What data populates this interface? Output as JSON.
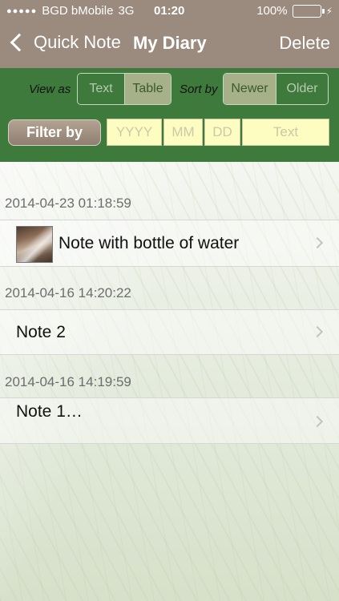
{
  "status_bar": {
    "signal_dots": "●●●●●",
    "carrier": "BGD bMobile",
    "network": "3G",
    "time": "01:20",
    "battery_percent": "100%",
    "battery_level": 1.0,
    "battery_color": "#4cd964"
  },
  "nav": {
    "back_label": "Quick Note",
    "title": "My Diary",
    "action_label": "Delete"
  },
  "controls": {
    "view_as_label": "View as",
    "view_options": [
      {
        "label": "Text",
        "selected": false
      },
      {
        "label": "Table",
        "selected": true
      }
    ],
    "sort_by_label": "Sort by",
    "sort_options": [
      {
        "label": "Newer",
        "selected": true
      },
      {
        "label": "Older",
        "selected": false
      }
    ],
    "filter_button_label": "Filter by",
    "filter_fields": {
      "year_placeholder": "YYYY",
      "month_placeholder": "MM",
      "day_placeholder": "DD",
      "text_placeholder": "Text"
    }
  },
  "entries": [
    {
      "timestamp": "2014-04-23 01:18:59",
      "title": "Note with bottle of water",
      "has_thumbnail": true
    },
    {
      "timestamp": "2014-04-16 14:20:22",
      "title": "Note 2",
      "has_thumbnail": false
    },
    {
      "timestamp": "2014-04-16 14:19:59",
      "title": "Note 1…",
      "has_thumbnail": false
    }
  ],
  "colors": {
    "nav_bar": "#9a8b7e",
    "panel_green": "#3d7a3b",
    "selected_segment": "#a6b089",
    "input_background": "#fdfdc2"
  }
}
